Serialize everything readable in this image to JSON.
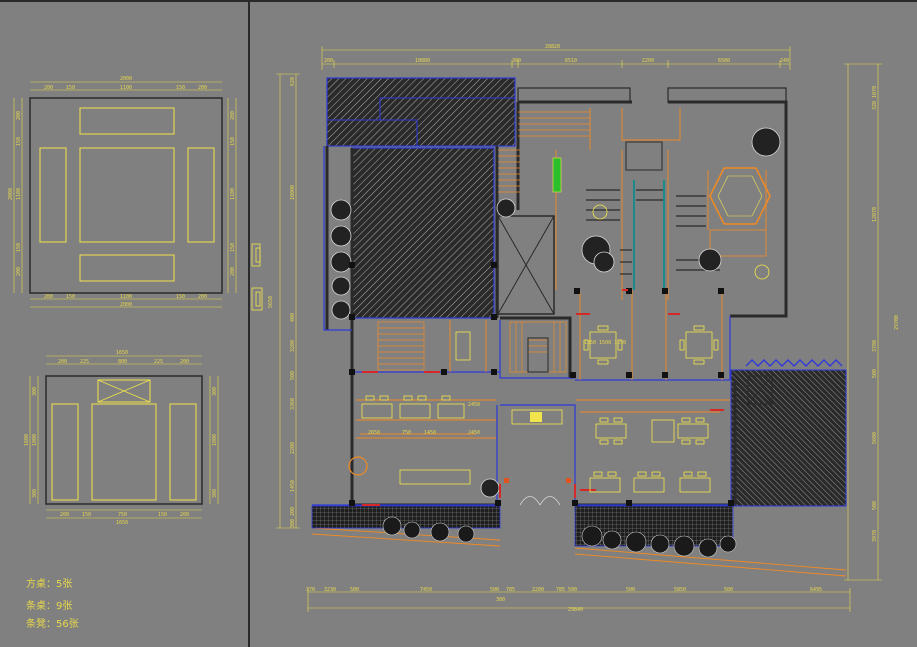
{
  "detail_square_table": {
    "top_overall": "2000",
    "top_parts": [
      "200",
      "150",
      "1100",
      "150",
      "200"
    ],
    "bottom_parts": [
      "200",
      "150",
      "1100",
      "150",
      "200"
    ],
    "bottom_overall": "2000",
    "left_parts": [
      "200",
      "150",
      "1100",
      "150",
      "200"
    ],
    "right_parts": [
      "200",
      "150",
      "1100",
      "150",
      "200"
    ],
    "side_overall": "2000"
  },
  "detail_rect_table": {
    "top_overall": "1650",
    "top_parts": [
      "200",
      "225",
      "800",
      "225",
      "200"
    ],
    "bottom_parts": [
      "200",
      "150",
      "750",
      "150",
      "200"
    ],
    "bottom_overall": "1650",
    "left_parts": [
      "300",
      "1000",
      "300"
    ],
    "right_parts": [
      "300",
      "1000",
      "300"
    ],
    "side_overall": "1600"
  },
  "plan": {
    "top_overall": "28820",
    "top_parts": [
      "200",
      "10880",
      "300",
      "6510",
      "2200",
      "6580",
      "240"
    ],
    "bottom_parts": [
      "370",
      "3230",
      "500",
      "7450",
      "500",
      "785",
      "2200",
      "785 500",
      "500",
      "5850",
      "500",
      "6495"
    ],
    "bottom_sub": "300",
    "bottom_overall": "29840",
    "left_parts": [
      "620",
      "10000",
      "400",
      "3200",
      "500",
      "3360",
      "2200",
      "1450",
      "300 200"
    ],
    "left_overall": "26680",
    "right_parts": [
      "320 1070",
      "12070",
      "3700",
      "500",
      "5600",
      "500",
      "3970"
    ],
    "right_overall": "29700",
    "interior": [
      "2450",
      "2450",
      "1450",
      "750",
      "2650",
      "1550 1500 1550"
    ]
  },
  "legend": {
    "square_table": "方桌：5张",
    "long_table": "条桌：9张",
    "chairs": "条凳：56张"
  },
  "colors": {
    "background": "#808080",
    "dimension": "#e8d84a",
    "wall": "#2a2a2a",
    "furniture": "#f2e44c",
    "structure": "#2e3ad8",
    "fixture": "#f08a24",
    "window": "#d62828"
  }
}
